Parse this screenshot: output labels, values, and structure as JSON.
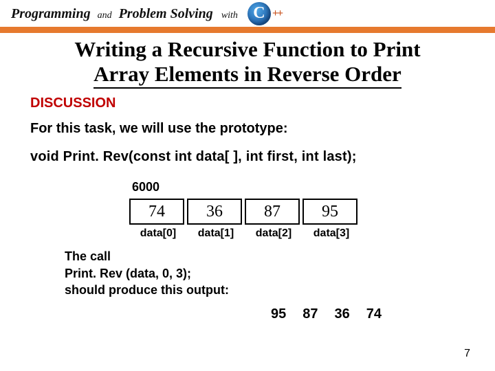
{
  "header": {
    "brand": {
      "programming": "Programming",
      "and": "and",
      "problem_solving": "Problem Solving",
      "with": "with",
      "logo_c": "C",
      "logo_plus": "++"
    }
  },
  "title": {
    "line1": "Writing a Recursive Function to Print",
    "line2": "Array Elements in Reverse Order"
  },
  "section_heading": "DISCUSSION",
  "body": {
    "intro": "For this task, we will use the prototype:",
    "prototype": "void Print. Rev(const  int  data[ ],  int  first,   int  last);"
  },
  "array": {
    "address": "6000",
    "values": [
      "74",
      "36",
      "87",
      "95"
    ],
    "labels": [
      "data[0]",
      "data[1]",
      "data[2]",
      "data[3]"
    ]
  },
  "call": {
    "line1": "The call",
    "line2": "Print. Rev (data, 0, 3);",
    "line3": "should produce this output:"
  },
  "output": [
    "95",
    "87",
    "36",
    "74"
  ],
  "page_number": "7"
}
